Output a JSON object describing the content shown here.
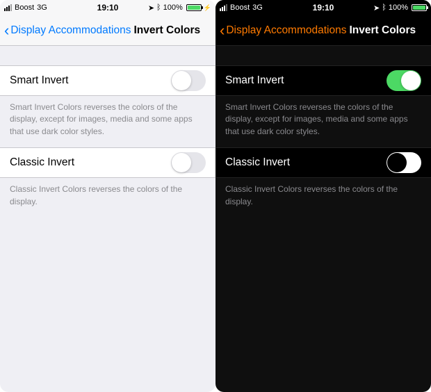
{
  "status": {
    "carrier": "Boost",
    "network": "3G",
    "time": "19:10",
    "battery_pct": "100%"
  },
  "nav": {
    "back_label": "Display Accommodations",
    "title": "Invert Colors"
  },
  "smart": {
    "label": "Smart Invert",
    "desc": "Smart Invert Colors reverses the colors of the display, except for images, media and some apps that use dark color styles."
  },
  "classic": {
    "label": "Classic Invert",
    "desc": "Classic Invert Colors reverses the colors of the display."
  }
}
